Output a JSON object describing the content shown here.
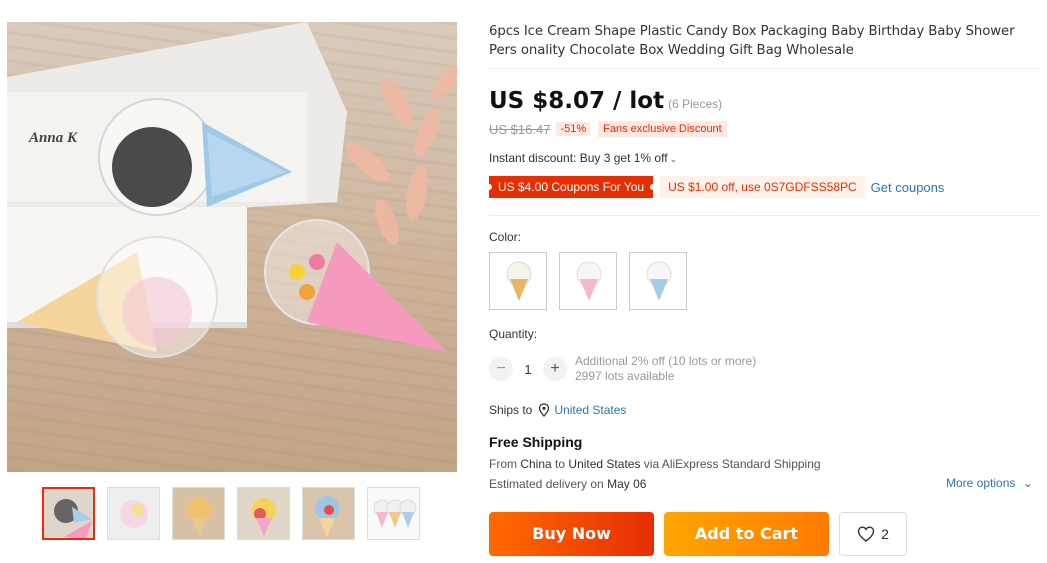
{
  "product": {
    "title": "6pcs Ice Cream Shape Plastic Candy Box Packaging Baby Birthday Baby Shower Pers onality Chocolate Box Wedding Gift Bag Wholesale",
    "price": "US $8.07 / lot",
    "price_unit": "(6 Pieces)",
    "original_price": "US $16.47",
    "discount_pct": "-51%",
    "fans_badge": "Fans exclusive Discount",
    "book_lettering": "Anna K"
  },
  "promotions": {
    "instant_discount": "Instant discount: Buy 3 get 1% off",
    "coupon_store": "US $4.00 Coupons For You",
    "coupon_code": "US $1.00 off, use 0S7GDFSS58PC",
    "get_coupons": "Get coupons"
  },
  "options": {
    "color_label": "Color:",
    "colors": [
      "yellow",
      "pink",
      "blue"
    ]
  },
  "quantity": {
    "label": "Quantity:",
    "minus": "−",
    "value": "1",
    "plus": "+",
    "note_line1": "Additional 2% off (10 lots or more)",
    "note_line2": "2997 lots available"
  },
  "shipping": {
    "ships_to_label": "Ships to",
    "ships_to_country": "United States",
    "free_shipping": "Free Shipping",
    "from_prefix": "From",
    "from_country": "China",
    "to_word": "to",
    "to_country": "United States",
    "via": "via AliExpress Standard Shipping",
    "delivery_prefix": "Estimated delivery on",
    "delivery_date": "May 06",
    "more_options": "More options"
  },
  "actions": {
    "buy_now": "Buy Now",
    "add_to_cart": "Add to Cart",
    "wish_count": "2"
  },
  "colors": {
    "accent_red": "#e62e04",
    "accent_orange": "#ff7a00",
    "link_blue": "#2e74b5"
  }
}
